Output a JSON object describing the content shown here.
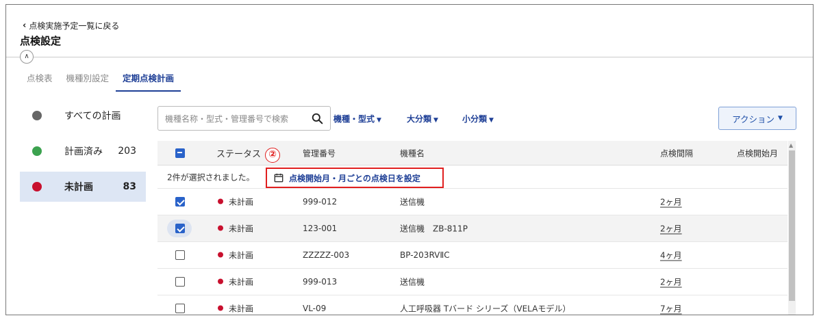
{
  "header": {
    "back_label": "点検実施予定一覧に戻る",
    "title": "点検設定"
  },
  "tabs": [
    {
      "label": "点検表",
      "active": false
    },
    {
      "label": "機種別設定",
      "active": false
    },
    {
      "label": "定期点検計画",
      "active": true
    }
  ],
  "sidebar": {
    "items": [
      {
        "label": "すべての計画",
        "count": "",
        "color": "#666666",
        "active": false
      },
      {
        "label": "計画済み",
        "count": "203",
        "color": "#3ca24f",
        "active": false
      },
      {
        "label": "未計画",
        "count": "83",
        "color": "#c8102e",
        "active": true
      }
    ]
  },
  "toolbar": {
    "search_placeholder": "機種名称・型式・管理番号で検索",
    "filters": [
      "機種・型式",
      "大分類",
      "小分類"
    ],
    "action_label": "アクション"
  },
  "table": {
    "columns": [
      "ステータス",
      "管理番号",
      "機種名",
      "点検間隔",
      "点検開始月"
    ],
    "selection_message": "2件が選択されました。",
    "selection_action": "点検開始月・月ごとの点検日を設定",
    "annotation_badge": "②",
    "rows": [
      {
        "checked": true,
        "status": "未計画",
        "id": "999-012",
        "name": "送信機",
        "interval": "2ヶ月",
        "start": ""
      },
      {
        "checked": true,
        "status": "未計画",
        "id": "123-001",
        "name": "送信機　ZB-811P",
        "interval": "2ヶ月",
        "start": ""
      },
      {
        "checked": false,
        "status": "未計画",
        "id": "ZZZZZ-003",
        "name": "BP-203RVⅡC",
        "interval": "4ヶ月",
        "start": ""
      },
      {
        "checked": false,
        "status": "未計画",
        "id": "999-013",
        "name": "送信機",
        "interval": "2ヶ月",
        "start": ""
      },
      {
        "checked": false,
        "status": "未計画",
        "id": "VL-09",
        "name": "人工呼吸器 Tバード シリーズ（VELAモデル）",
        "interval": "7ヶ月",
        "start": ""
      }
    ]
  }
}
